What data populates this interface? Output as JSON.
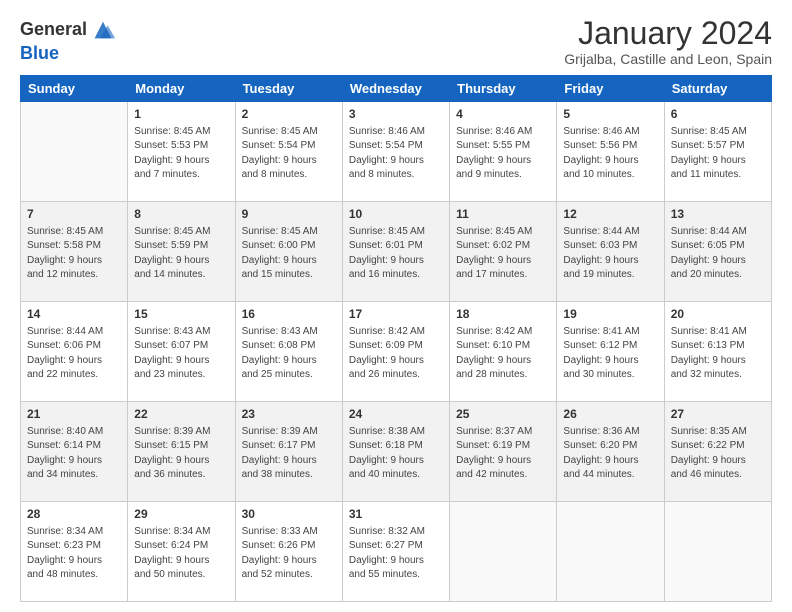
{
  "header": {
    "logo_general": "General",
    "logo_blue": "Blue",
    "month_title": "January 2024",
    "location": "Grijalba, Castille and Leon, Spain"
  },
  "weekdays": [
    "Sunday",
    "Monday",
    "Tuesday",
    "Wednesday",
    "Thursday",
    "Friday",
    "Saturday"
  ],
  "weeks": [
    [
      {
        "day": "",
        "sunrise": "",
        "sunset": "",
        "daylight": ""
      },
      {
        "day": "1",
        "sunrise": "Sunrise: 8:45 AM",
        "sunset": "Sunset: 5:53 PM",
        "daylight": "Daylight: 9 hours and 7 minutes."
      },
      {
        "day": "2",
        "sunrise": "Sunrise: 8:45 AM",
        "sunset": "Sunset: 5:54 PM",
        "daylight": "Daylight: 9 hours and 8 minutes."
      },
      {
        "day": "3",
        "sunrise": "Sunrise: 8:46 AM",
        "sunset": "Sunset: 5:54 PM",
        "daylight": "Daylight: 9 hours and 8 minutes."
      },
      {
        "day": "4",
        "sunrise": "Sunrise: 8:46 AM",
        "sunset": "Sunset: 5:55 PM",
        "daylight": "Daylight: 9 hours and 9 minutes."
      },
      {
        "day": "5",
        "sunrise": "Sunrise: 8:46 AM",
        "sunset": "Sunset: 5:56 PM",
        "daylight": "Daylight: 9 hours and 10 minutes."
      },
      {
        "day": "6",
        "sunrise": "Sunrise: 8:45 AM",
        "sunset": "Sunset: 5:57 PM",
        "daylight": "Daylight: 9 hours and 11 minutes."
      }
    ],
    [
      {
        "day": "7",
        "sunrise": "Sunrise: 8:45 AM",
        "sunset": "Sunset: 5:58 PM",
        "daylight": "Daylight: 9 hours and 12 minutes."
      },
      {
        "day": "8",
        "sunrise": "Sunrise: 8:45 AM",
        "sunset": "Sunset: 5:59 PM",
        "daylight": "Daylight: 9 hours and 14 minutes."
      },
      {
        "day": "9",
        "sunrise": "Sunrise: 8:45 AM",
        "sunset": "Sunset: 6:00 PM",
        "daylight": "Daylight: 9 hours and 15 minutes."
      },
      {
        "day": "10",
        "sunrise": "Sunrise: 8:45 AM",
        "sunset": "Sunset: 6:01 PM",
        "daylight": "Daylight: 9 hours and 16 minutes."
      },
      {
        "day": "11",
        "sunrise": "Sunrise: 8:45 AM",
        "sunset": "Sunset: 6:02 PM",
        "daylight": "Daylight: 9 hours and 17 minutes."
      },
      {
        "day": "12",
        "sunrise": "Sunrise: 8:44 AM",
        "sunset": "Sunset: 6:03 PM",
        "daylight": "Daylight: 9 hours and 19 minutes."
      },
      {
        "day": "13",
        "sunrise": "Sunrise: 8:44 AM",
        "sunset": "Sunset: 6:05 PM",
        "daylight": "Daylight: 9 hours and 20 minutes."
      }
    ],
    [
      {
        "day": "14",
        "sunrise": "Sunrise: 8:44 AM",
        "sunset": "Sunset: 6:06 PM",
        "daylight": "Daylight: 9 hours and 22 minutes."
      },
      {
        "day": "15",
        "sunrise": "Sunrise: 8:43 AM",
        "sunset": "Sunset: 6:07 PM",
        "daylight": "Daylight: 9 hours and 23 minutes."
      },
      {
        "day": "16",
        "sunrise": "Sunrise: 8:43 AM",
        "sunset": "Sunset: 6:08 PM",
        "daylight": "Daylight: 9 hours and 25 minutes."
      },
      {
        "day": "17",
        "sunrise": "Sunrise: 8:42 AM",
        "sunset": "Sunset: 6:09 PM",
        "daylight": "Daylight: 9 hours and 26 minutes."
      },
      {
        "day": "18",
        "sunrise": "Sunrise: 8:42 AM",
        "sunset": "Sunset: 6:10 PM",
        "daylight": "Daylight: 9 hours and 28 minutes."
      },
      {
        "day": "19",
        "sunrise": "Sunrise: 8:41 AM",
        "sunset": "Sunset: 6:12 PM",
        "daylight": "Daylight: 9 hours and 30 minutes."
      },
      {
        "day": "20",
        "sunrise": "Sunrise: 8:41 AM",
        "sunset": "Sunset: 6:13 PM",
        "daylight": "Daylight: 9 hours and 32 minutes."
      }
    ],
    [
      {
        "day": "21",
        "sunrise": "Sunrise: 8:40 AM",
        "sunset": "Sunset: 6:14 PM",
        "daylight": "Daylight: 9 hours and 34 minutes."
      },
      {
        "day": "22",
        "sunrise": "Sunrise: 8:39 AM",
        "sunset": "Sunset: 6:15 PM",
        "daylight": "Daylight: 9 hours and 36 minutes."
      },
      {
        "day": "23",
        "sunrise": "Sunrise: 8:39 AM",
        "sunset": "Sunset: 6:17 PM",
        "daylight": "Daylight: 9 hours and 38 minutes."
      },
      {
        "day": "24",
        "sunrise": "Sunrise: 8:38 AM",
        "sunset": "Sunset: 6:18 PM",
        "daylight": "Daylight: 9 hours and 40 minutes."
      },
      {
        "day": "25",
        "sunrise": "Sunrise: 8:37 AM",
        "sunset": "Sunset: 6:19 PM",
        "daylight": "Daylight: 9 hours and 42 minutes."
      },
      {
        "day": "26",
        "sunrise": "Sunrise: 8:36 AM",
        "sunset": "Sunset: 6:20 PM",
        "daylight": "Daylight: 9 hours and 44 minutes."
      },
      {
        "day": "27",
        "sunrise": "Sunrise: 8:35 AM",
        "sunset": "Sunset: 6:22 PM",
        "daylight": "Daylight: 9 hours and 46 minutes."
      }
    ],
    [
      {
        "day": "28",
        "sunrise": "Sunrise: 8:34 AM",
        "sunset": "Sunset: 6:23 PM",
        "daylight": "Daylight: 9 hours and 48 minutes."
      },
      {
        "day": "29",
        "sunrise": "Sunrise: 8:34 AM",
        "sunset": "Sunset: 6:24 PM",
        "daylight": "Daylight: 9 hours and 50 minutes."
      },
      {
        "day": "30",
        "sunrise": "Sunrise: 8:33 AM",
        "sunset": "Sunset: 6:26 PM",
        "daylight": "Daylight: 9 hours and 52 minutes."
      },
      {
        "day": "31",
        "sunrise": "Sunrise: 8:32 AM",
        "sunset": "Sunset: 6:27 PM",
        "daylight": "Daylight: 9 hours and 55 minutes."
      },
      {
        "day": "",
        "sunrise": "",
        "sunset": "",
        "daylight": ""
      },
      {
        "day": "",
        "sunrise": "",
        "sunset": "",
        "daylight": ""
      },
      {
        "day": "",
        "sunrise": "",
        "sunset": "",
        "daylight": ""
      }
    ]
  ]
}
